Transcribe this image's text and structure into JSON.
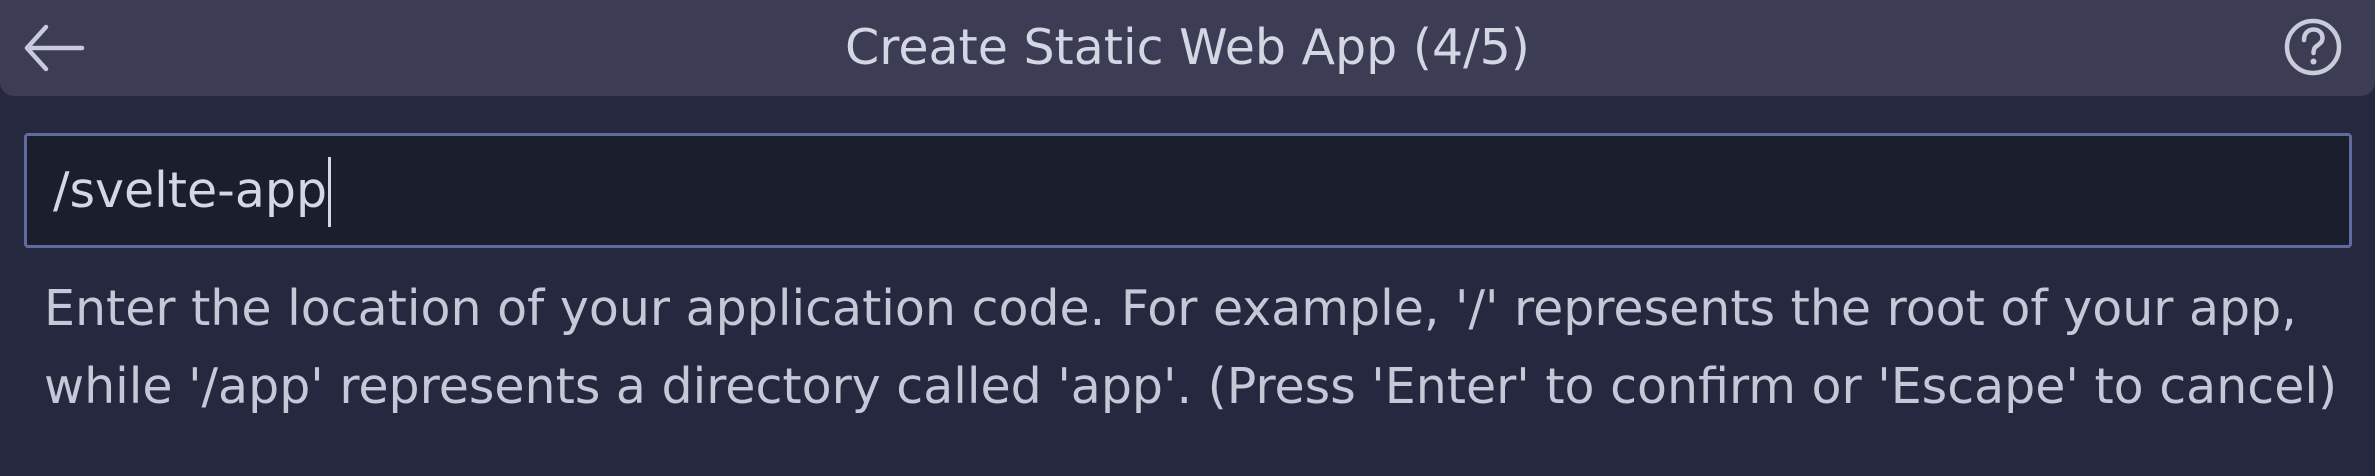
{
  "header": {
    "title": "Create Static Web App (4/5)",
    "back_icon": "arrow-left-icon",
    "help_icon": "question-circle-icon"
  },
  "input": {
    "value": "/svelte-app"
  },
  "message": {
    "lines": [
      "Enter the location of your application code. For example, '/' represents the root of your app,",
      "while '/app' represents a directory called 'app'. (Press 'Enter' to confirm or 'Escape' to cancel)"
    ]
  },
  "colors": {
    "background": "#262840",
    "title_bar": "#3c3d54",
    "input_background": "#1b1e2c",
    "input_border": "#616c9c",
    "text": "#d3d6e3"
  }
}
